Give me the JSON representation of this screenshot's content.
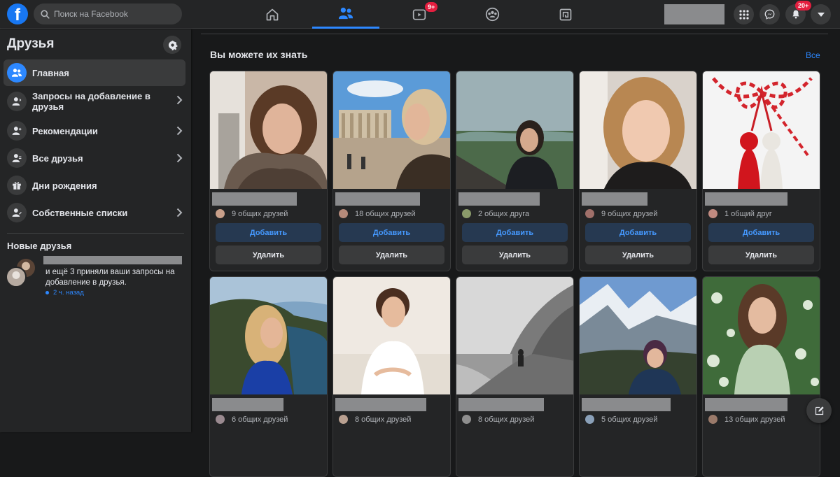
{
  "app": {
    "logo_letter": "f"
  },
  "search": {
    "placeholder": "Поиск на Facebook"
  },
  "nav": {
    "tabs": [
      {
        "name": "home",
        "badge": ""
      },
      {
        "name": "friends",
        "badge": ""
      },
      {
        "name": "watch",
        "badge": "9+"
      },
      {
        "name": "groups",
        "badge": ""
      },
      {
        "name": "gaming",
        "badge": ""
      }
    ],
    "notifications_badge": "20+"
  },
  "sidebar": {
    "title": "Друзья",
    "items": [
      {
        "label": "Главная",
        "icon": "friends-icon",
        "active": true
      },
      {
        "label": "Запросы на добавление в друзья",
        "icon": "friend-request-icon"
      },
      {
        "label": "Рекомендации",
        "icon": "friend-suggest-icon"
      },
      {
        "label": "Все друзья",
        "icon": "all-friends-icon"
      },
      {
        "label": "Дни рождения",
        "icon": "gift-icon"
      },
      {
        "label": "Собственные списки",
        "icon": "custom-list-icon"
      }
    ],
    "new_friends": {
      "title": "Новые друзья",
      "text": "и ещё 3 приняли ваши запросы на добавление в друзья.",
      "time": "2 ч. назад"
    }
  },
  "main": {
    "section_title": "Вы можете их знать",
    "see_all": "Все",
    "add_label": "Добавить",
    "remove_label": "Удалить",
    "cards": [
      {
        "mutual": "9 общих друзей"
      },
      {
        "mutual": "18 общих друзей"
      },
      {
        "mutual": "2 общих друга"
      },
      {
        "mutual": "9 общих друзей"
      },
      {
        "mutual": "1 общий друг"
      },
      {
        "mutual": "6 общих друзей"
      },
      {
        "mutual": "8 общих друзей"
      },
      {
        "mutual": "8 общих друзей"
      },
      {
        "mutual": "5 общих друзей"
      },
      {
        "mutual": "13 общих друзей"
      }
    ]
  },
  "colors": {
    "background": "#18191a",
    "surface": "#242526",
    "accent": "#2d88ff",
    "badge": "#e41e3f"
  }
}
